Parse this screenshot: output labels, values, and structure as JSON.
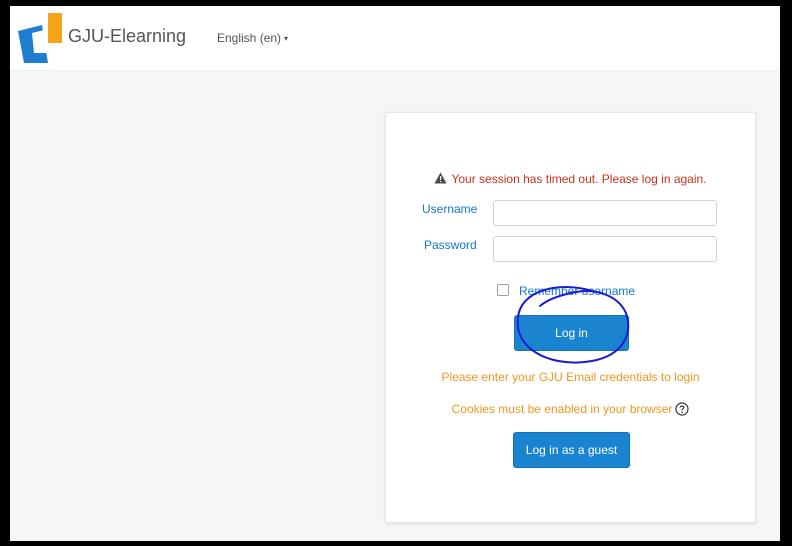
{
  "header": {
    "site_name": "GJU-Elearning",
    "language": "English (en)",
    "caret": "▾"
  },
  "login": {
    "error_message": "Your session has timed out. Please log in again.",
    "username_label": "Username",
    "username_value": "",
    "password_label": "Password",
    "password_value": "",
    "remember_label": "Remember username",
    "login_button": "Log in",
    "email_note": "Please enter your GJU Email credentials to login",
    "cookies_note": "Cookies must be enabled in your browser",
    "guest_button": "Log in as a guest"
  },
  "colors": {
    "primary": "#1b84d0",
    "link": "#1177d1",
    "error": "#ca3120",
    "warning_text": "#f0961c",
    "annotation_ink": "#1a1ad6",
    "logo_orange": "#f7a21b",
    "logo_blue": "#1f7ed0"
  },
  "icons": {
    "warning": "warning-triangle-icon",
    "help": "question-circle-icon",
    "caret": "caret-down-icon"
  }
}
